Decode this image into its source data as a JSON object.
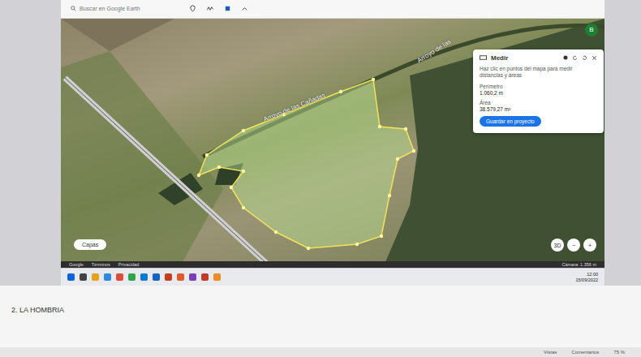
{
  "search": {
    "placeholder": "Buscar en Google Earth"
  },
  "avatar": "B",
  "map": {
    "labels": [
      "Arroyo de las Cañadas",
      "Arroyo de las"
    ],
    "layers_button": "Capas",
    "controls": [
      "3D",
      "−",
      "+"
    ]
  },
  "measure": {
    "title": "Medir",
    "hint": "Haz clic en puntos del mapa para medir distancias y áreas",
    "perimeter": {
      "label": "Perímetro",
      "value": "1.060,2 m"
    },
    "area": {
      "label": "Área",
      "value": "38.579,27 m²"
    },
    "button": "Guardar en proyecto"
  },
  "footer": {
    "links": [
      "Google",
      "Términos",
      "Privacidad"
    ],
    "camera": "Cámara: 1.356 m"
  },
  "taskbar": {
    "time": "12:00",
    "date": "15/09/2022"
  },
  "document": {
    "heading": "2. LA HOMBRIA"
  },
  "status_bar": {
    "items": [
      "Vistas",
      "Comentarios"
    ],
    "zoom": "75 %"
  }
}
